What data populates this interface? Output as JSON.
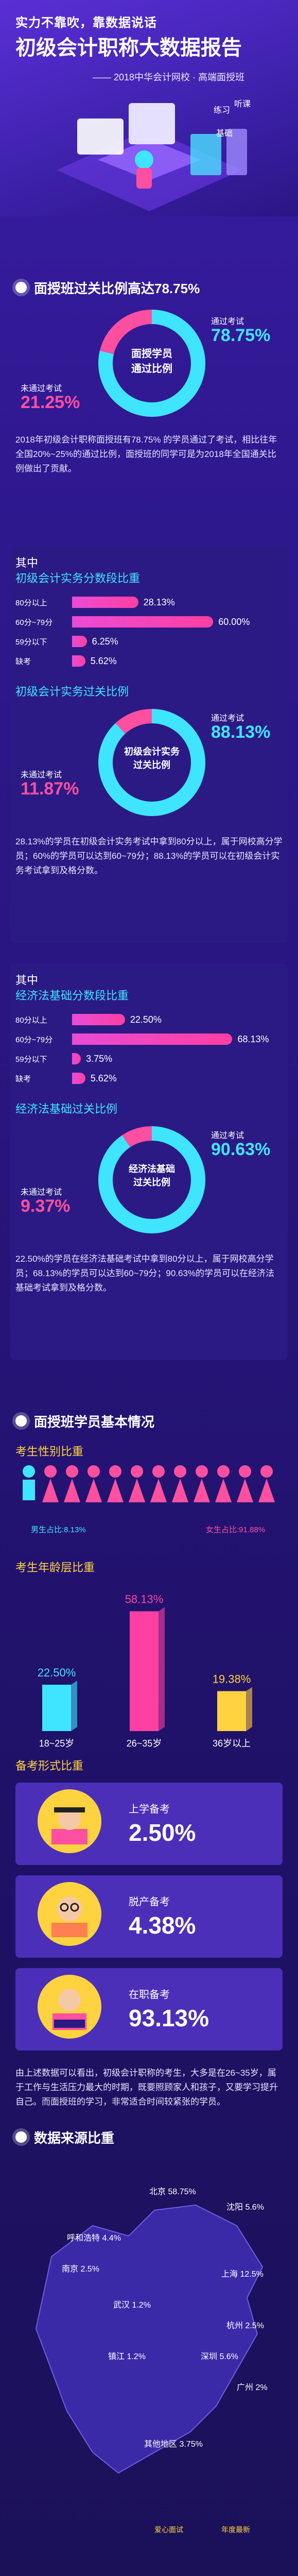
{
  "hero": {
    "tag": "实力不靠吹，靠数据说话",
    "title": "初级会计职称大数据报告",
    "subtitle": "—— 2018中华会计网校 · 高端面授班",
    "art_labels": [
      "练习",
      "听课",
      "基础"
    ]
  },
  "section1": {
    "heading": "面授班过关比例高达78.75%",
    "donut": {
      "center": "面授学员\n通过比例",
      "pass_label": "通过考试",
      "pass_value": "78.75%",
      "fail_label": "未通过考试",
      "fail_value": "21.25%"
    },
    "para": "2018年初级会计职称面授班有78.75% 的学员通过了考试，相比往年全国20%~25%的通过比例，面授班的同学可是为2018年全国通关比例做出了贡献。"
  },
  "section2": {
    "intro": "其中",
    "heading": "初级会计实务分数段比重",
    "bars": [
      {
        "label": "80分以上",
        "value": 28.13,
        "text": "28.13%"
      },
      {
        "label": "60分~79分",
        "value": 60.0,
        "text": "60.00%"
      },
      {
        "label": "59分以下",
        "value": 6.25,
        "text": "6.25%"
      },
      {
        "label": "缺考",
        "value": 5.62,
        "text": "5.62%"
      }
    ],
    "pass_heading": "初级会计实务过关比例",
    "donut": {
      "center": "初级会计实务\n过关比例",
      "pass_label": "通过考试",
      "pass_value": "88.13%",
      "fail_label": "未通过考试",
      "fail_value": "11.87%"
    },
    "para": "28.13%的学员在初级会计实务考试中拿到80分以上，属于网校高分学员；60%的学员可以达到60~79分；88.13%的学员可以在初级会计实务考试拿到及格分数。"
  },
  "section3": {
    "intro": "其中",
    "heading": "经济法基础分数段比重",
    "bars": [
      {
        "label": "80分以上",
        "value": 22.5,
        "text": "22.50%"
      },
      {
        "label": "60分~79分",
        "value": 68.13,
        "text": "68.13%"
      },
      {
        "label": "59分以下",
        "value": 3.75,
        "text": "3.75%"
      },
      {
        "label": "缺考",
        "value": 5.62,
        "text": "5.62%"
      }
    ],
    "pass_heading": "经济法基础过关比例",
    "donut": {
      "center": "经济法基础\n过关比例",
      "pass_label": "通过考试",
      "pass_value": "90.63%",
      "fail_label": "未通过考试",
      "fail_value": "9.37%"
    },
    "para": "22.50%的学员在经济法基础考试中拿到80分以上，属于网校高分学员；68.13%的学员可以达到60~79分；90.63%的学员可以在经济法基础考试拿到及格分数。"
  },
  "section4": {
    "heading": "面授班学员基本情况",
    "gender_heading": "考生性别比重",
    "male_label": "男生占比:8.13%",
    "female_label": "女生占比:91.88%",
    "male_count": 1,
    "female_count": 11,
    "age_heading": "考生年龄层比重"
  },
  "chart_data": [
    {
      "type": "pie",
      "title": "面授班过关比例高达78.75%",
      "labels": [
        "通过考试",
        "未通过考试"
      ],
      "values": [
        78.75,
        21.25
      ]
    },
    {
      "type": "bar",
      "title": "初级会计实务分数段比重",
      "categories": [
        "80分以上",
        "60分~79分",
        "59分以下",
        "缺考"
      ],
      "values": [
        28.13,
        60.0,
        6.25,
        5.62
      ]
    },
    {
      "type": "pie",
      "title": "初级会计实务过关比例",
      "labels": [
        "通过考试",
        "未通过考试"
      ],
      "values": [
        88.13,
        11.87
      ]
    },
    {
      "type": "bar",
      "title": "经济法基础分数段比重",
      "categories": [
        "80分以上",
        "60分~79分",
        "59分以下",
        "缺考"
      ],
      "values": [
        22.5,
        68.13,
        3.75,
        5.62
      ]
    },
    {
      "type": "pie",
      "title": "经济法基础过关比例",
      "labels": [
        "通过考试",
        "未通过考试"
      ],
      "values": [
        90.63,
        9.37
      ]
    },
    {
      "type": "bar",
      "title": "考生年龄层比重",
      "categories": [
        "18~25岁",
        "26~35岁",
        "36岁以上"
      ],
      "values": [
        22.5,
        58.13,
        19.38
      ],
      "labels": [
        "22.50%",
        "58.13%",
        "19.38%"
      ]
    },
    {
      "type": "bar",
      "title": "备考形式比重",
      "categories": [
        "上学备考",
        "脱产备考",
        "在职备考"
      ],
      "values": [
        2.5,
        4.38,
        93.13
      ],
      "labels": [
        "2.50%",
        "4.38%",
        "93.13%"
      ]
    }
  ],
  "age": {
    "bars": [
      {
        "label": "18~25岁",
        "value": 22.5,
        "text": "22.50%",
        "color": "#3fe5ff"
      },
      {
        "label": "26~35岁",
        "value": 58.13,
        "text": "58.13%",
        "color": "#ff3fa2"
      },
      {
        "label": "36岁以上",
        "value": 19.38,
        "text": "19.38%",
        "color": "#ffd23f"
      }
    ]
  },
  "section5": {
    "heading": "备考形式比重",
    "items": [
      {
        "label": "上学备考",
        "value": "2.50%",
        "icon": "student-icon"
      },
      {
        "label": "脱产备考",
        "value": "4.38%",
        "icon": "reader-icon"
      },
      {
        "label": "在职备考",
        "value": "93.13%",
        "icon": "worker-icon"
      }
    ],
    "para": "由上述数据可以看出，初级会计职称的考生，大多是在26~35岁，属于工作与生活压力最大的时期，既要照顾家人和孩子，又要学习提升自己。而面授班的学习，非常适合时间较紧张的学员。"
  },
  "section6": {
    "heading": "数据来源比重",
    "regions": [
      {
        "name": "北京",
        "value": "58.75%"
      },
      {
        "name": "沈阳",
        "value": "5.6%"
      },
      {
        "name": "呼和浩特",
        "value": "4.4%"
      },
      {
        "name": "南京",
        "value": "2.5%"
      },
      {
        "name": "上海",
        "value": "12.5%"
      },
      {
        "name": "武汉",
        "value": "1.2%"
      },
      {
        "name": "杭州",
        "value": "2.5%"
      },
      {
        "name": "镇江",
        "value": "1.2%"
      },
      {
        "name": "深圳",
        "value": "5.6%"
      },
      {
        "name": "广州",
        "value": "2%"
      },
      {
        "name": "其他地区",
        "value": "3.75%"
      }
    ],
    "footer_left": "爱心面试",
    "footer_right": "年度最新"
  }
}
